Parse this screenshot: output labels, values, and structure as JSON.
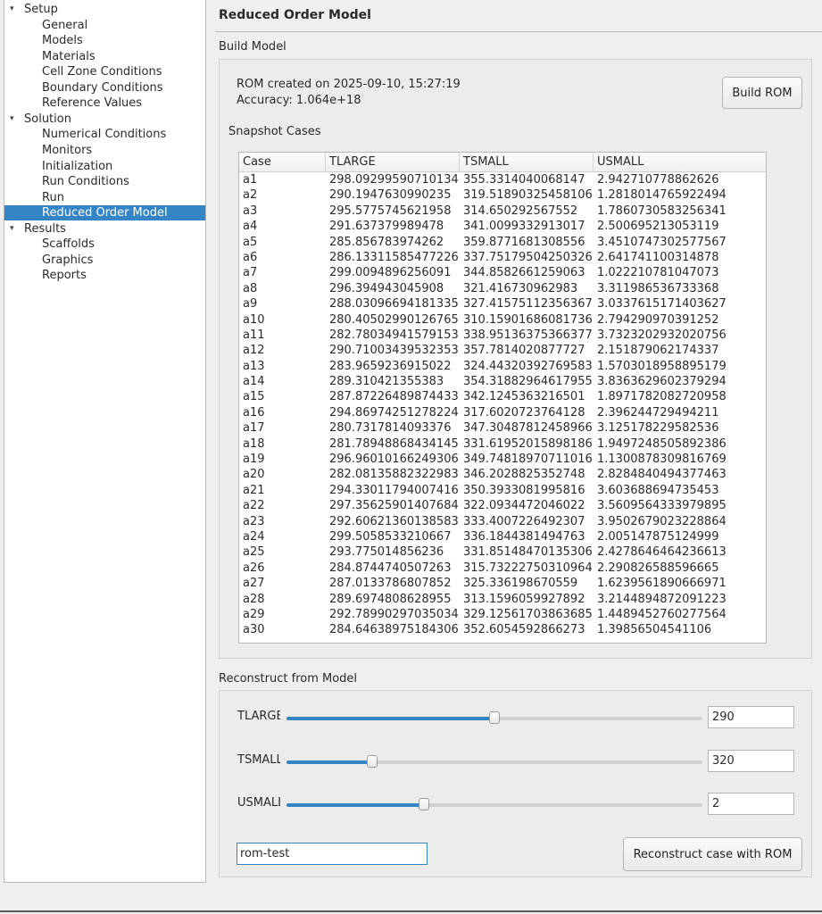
{
  "tree": [
    {
      "label": "Setup",
      "level": 0,
      "expanded": true
    },
    {
      "label": "General",
      "level": 1
    },
    {
      "label": "Models",
      "level": 1
    },
    {
      "label": "Materials",
      "level": 1
    },
    {
      "label": "Cell Zone Conditions",
      "level": 1
    },
    {
      "label": "Boundary Conditions",
      "level": 1
    },
    {
      "label": "Reference Values",
      "level": 1
    },
    {
      "label": "Solution",
      "level": 0,
      "expanded": true
    },
    {
      "label": "Numerical Conditions",
      "level": 1
    },
    {
      "label": "Monitors",
      "level": 1
    },
    {
      "label": "Initialization",
      "level": 1
    },
    {
      "label": "Run Conditions",
      "level": 1
    },
    {
      "label": "Run",
      "level": 1
    },
    {
      "label": "Reduced Order Model",
      "level": 1,
      "selected": true
    },
    {
      "label": "Results",
      "level": 0,
      "expanded": true
    },
    {
      "label": "Scaffolds",
      "level": 1
    },
    {
      "label": "Graphics",
      "level": 1
    },
    {
      "label": "Reports",
      "level": 1
    }
  ],
  "page": {
    "title": "Reduced Order Model",
    "build_section": "Build Model",
    "rom_created": "ROM created on 2025-09-10, 15:27:19",
    "accuracy": "Accuracy: 1.064e+18",
    "build_button": "Build ROM",
    "snapshot_label": "Snapshot Cases",
    "reconstruct_section": "Reconstruct from Model",
    "case_name": "rom-test",
    "reconstruct_button": "Reconstruct case with ROM"
  },
  "table": {
    "headers": [
      "Case",
      "TLARGE",
      "TSMALL",
      "USMALL"
    ],
    "rows": [
      [
        "a1",
        "298.09299590710134",
        "355.3314040068147",
        "2.942710778862626"
      ],
      [
        "a2",
        "290.1947630990235",
        "319.51890325458106",
        "1.2818014765922494"
      ],
      [
        "a3",
        "295.5775745621958",
        "314.650292567552",
        "1.7860730583256341"
      ],
      [
        "a4",
        "291.637379989478",
        "341.0099332913017",
        "2.500695213053119"
      ],
      [
        "a5",
        "285.856783974262",
        "359.8771681308556",
        "3.4510747302577567"
      ],
      [
        "a6",
        "286.13311585477226",
        "337.75179504250326",
        "2.641741100314878"
      ],
      [
        "a7",
        "299.0094896256091",
        "344.8582661259063",
        "1.022210781047073"
      ],
      [
        "a8",
        "296.394943045908",
        "321.416730962983",
        "3.311986536733368"
      ],
      [
        "a9",
        "288.03096694181335",
        "327.41575112356367",
        "3.0337615171403627"
      ],
      [
        "a10",
        "280.40502990126765",
        "310.15901686081736",
        "2.794290970391252"
      ],
      [
        "a11",
        "282.78034941579153",
        "338.95136375366377",
        "3.7323202932020756"
      ],
      [
        "a12",
        "290.71003439532353",
        "357.7814020877727",
        "2.151879062174337"
      ],
      [
        "a13",
        "283.9659236915022",
        "324.44320392769583",
        "1.5703018958895179"
      ],
      [
        "a14",
        "289.310421355383",
        "354.31882964617955",
        "3.8363629602379294"
      ],
      [
        "a15",
        "287.87226489874433",
        "342.1245363216501",
        "1.8971782082720958"
      ],
      [
        "a16",
        "294.86974251278224",
        "317.6020723764128",
        "2.396244729494211"
      ],
      [
        "a17",
        "280.7317814093376",
        "347.30487812458966",
        "3.125178229582536"
      ],
      [
        "a18",
        "281.78948868434145",
        "331.61952015898186",
        "1.9497248505892386"
      ],
      [
        "a19",
        "296.96010166249306",
        "349.74818970711016",
        "1.1300878309816769"
      ],
      [
        "a20",
        "282.08135882322983",
        "346.2028825352748",
        "2.8284840494377463"
      ],
      [
        "a21",
        "294.33011794007416",
        "350.3933081995816",
        "3.603688694735453"
      ],
      [
        "a22",
        "297.35625901407684",
        "322.0934472046022",
        "3.5609564333979895"
      ],
      [
        "a23",
        "292.60621360138583",
        "333.4007226492307",
        "3.9502679023228864"
      ],
      [
        "a24",
        "299.5058533210667",
        "336.1844381494763",
        "2.005147875124999"
      ],
      [
        "a25",
        "293.775014856236",
        "331.85148470135306",
        "2.4278646464236613"
      ],
      [
        "a26",
        "284.8744740507263",
        "315.73222750310964",
        "2.290826588596665"
      ],
      [
        "a27",
        "287.0133786807852",
        "325.336198670559",
        "1.6239561890666971"
      ],
      [
        "a28",
        "289.6974808628955",
        "313.1596059927892",
        "3.2144894872091223"
      ],
      [
        "a29",
        "292.78990297035034",
        "329.12561703863685",
        "1.4489452760277564"
      ],
      [
        "a30",
        "284.64638975184306",
        "352.6054592866273",
        "1.39856504541106"
      ]
    ]
  },
  "sliders": [
    {
      "label": "TLARGE",
      "value": "290",
      "fraction": 0.5
    },
    {
      "label": "TSMALL",
      "value": "320",
      "fraction": 0.205
    },
    {
      "label": "USMALL",
      "value": "2",
      "fraction": 0.33
    }
  ],
  "colors": {
    "accent": "#3584c6"
  }
}
